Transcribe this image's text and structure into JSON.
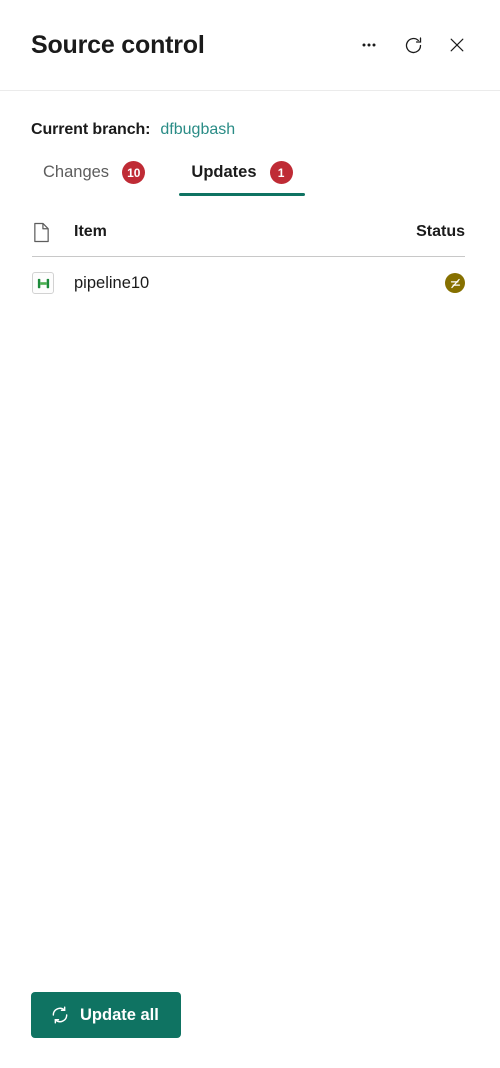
{
  "header": {
    "title": "Source control",
    "more_icon": "ellipsis-icon",
    "refresh_icon": "refresh-icon",
    "close_icon": "close-icon"
  },
  "branch": {
    "label": "Current branch:",
    "name": "dfbugbash",
    "name_color": "#2a8c86"
  },
  "tabs": [
    {
      "label": "Changes",
      "badge": "10",
      "active": false
    },
    {
      "label": "Updates",
      "badge": "1",
      "active": true
    }
  ],
  "tab_accent_color": "#0f7362",
  "badge_color": "#bf2b35",
  "table": {
    "header_icon": "file-icon",
    "columns": {
      "item": "Item",
      "status": "Status"
    },
    "rows": [
      {
        "icon": "pipeline-icon",
        "name": "pipeline10",
        "status_icon": "not-synced-icon",
        "status_color": "#867000"
      }
    ]
  },
  "footer": {
    "update_all_label": "Update all",
    "update_all_icon": "sync-icon",
    "button_color": "#0f7362"
  }
}
